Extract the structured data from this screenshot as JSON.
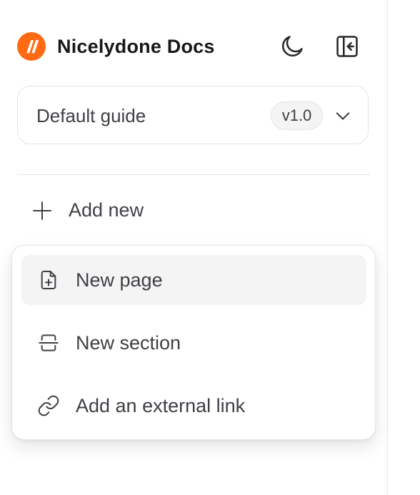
{
  "header": {
    "brand": "Nicelydone Docs",
    "logo_color": "#ff6a13",
    "icons": [
      "logo-icon",
      "moon-icon",
      "sidebar-collapse-icon"
    ]
  },
  "version_select": {
    "label": "Default guide",
    "badge": "v1.0",
    "icon": "chevron-down-icon"
  },
  "add_new": {
    "label": "Add new",
    "icon": "plus-icon"
  },
  "menu": {
    "items": [
      {
        "label": "New page",
        "icon": "file-plus-icon",
        "active": true
      },
      {
        "label": "New section",
        "icon": "section-icon",
        "active": false
      },
      {
        "label": "Add an external link",
        "icon": "link-icon",
        "active": false
      }
    ]
  },
  "colors": {
    "accent": "#ff6a13",
    "text": "#3f3f46",
    "border": "#e4e4e7",
    "hover": "#f4f4f5"
  }
}
